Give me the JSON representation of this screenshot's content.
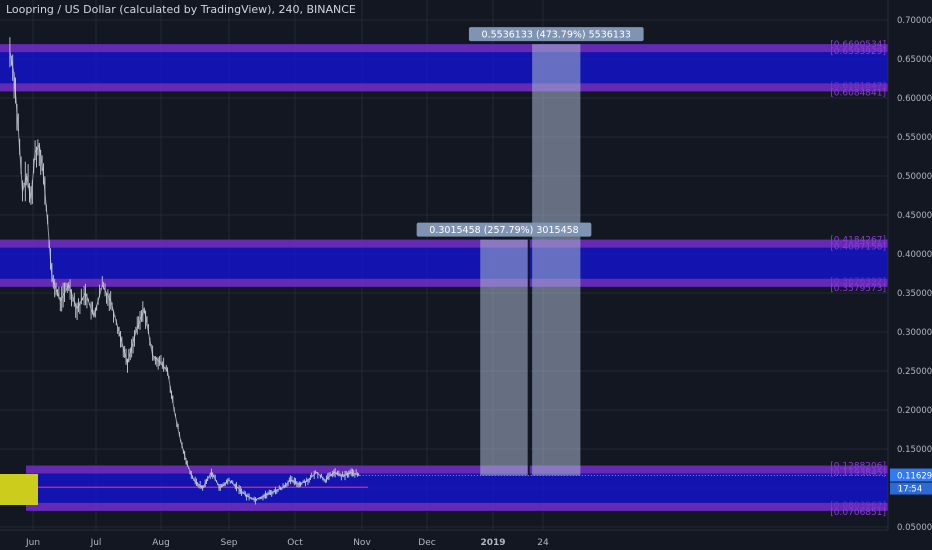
{
  "header": {
    "title": "Loopring / US Dollar (calculated by TradingView), 240, BINANCE"
  },
  "colors": {
    "background": "#131722",
    "grid": "#1f2a36",
    "axis_text": "#b2b5be",
    "zone_fill": "#1414e6",
    "zone_border": "#7a2fb5",
    "zone_label": "#8a3dd6",
    "measure_fill": "#a9b8d0",
    "measure_label_bg": "#7f93b3",
    "price_line": "#e0247f",
    "candle": "#c8ccd6",
    "price_tag": "#3179f5",
    "marker": "#cccc1c"
  },
  "chart_data": {
    "type": "line",
    "title": "Loopring / US Dollar (calculated by TradingView), 240, BINANCE",
    "xlabel": "",
    "ylabel": "",
    "grid": true,
    "x_ticks": [
      "Jun",
      "Jul",
      "Aug",
      "Sep",
      "Oct",
      "Nov",
      "Dec",
      "2019",
      "24"
    ],
    "y_ticks": [
      0.7,
      0.65,
      0.6,
      0.55,
      0.5,
      0.45,
      0.4,
      0.35,
      0.3,
      0.25,
      0.2,
      0.15,
      0.1,
      0.05
    ],
    "y_tick_labels": [
      "0.7000000",
      "0.6500000",
      "0.6000000",
      "0.5500000",
      "0.5000000",
      "0.4500000",
      "0.4000000",
      "0.3500000",
      "0.3000000",
      "0.2500000",
      "0.2000000",
      "0.1500000",
      "0.10",
      "0.0500000"
    ],
    "ylim": [
      0.03,
      0.718
    ],
    "current_price": {
      "value": 0.116,
      "label": "0.1162908",
      "countdown": "17:54"
    },
    "series": [
      {
        "values": [
          [
            "2018-05-21",
            0.66
          ],
          [
            "2018-05-23",
            0.63
          ],
          [
            "2018-05-25",
            0.56
          ],
          [
            "2018-05-27",
            0.48
          ],
          [
            "2018-05-29",
            0.5
          ],
          [
            "2018-05-31",
            0.47
          ],
          [
            "2018-06-02",
            0.53
          ],
          [
            "2018-06-04",
            0.54
          ],
          [
            "2018-06-06",
            0.5
          ],
          [
            "2018-06-08",
            0.44
          ],
          [
            "2018-06-10",
            0.37
          ],
          [
            "2018-06-14",
            0.34
          ],
          [
            "2018-06-18",
            0.36
          ],
          [
            "2018-06-22",
            0.33
          ],
          [
            "2018-06-26",
            0.35
          ],
          [
            "2018-06-30",
            0.32
          ],
          [
            "2018-07-04",
            0.36
          ],
          [
            "2018-07-08",
            0.34
          ],
          [
            "2018-07-12",
            0.3
          ],
          [
            "2018-07-16",
            0.26
          ],
          [
            "2018-07-20",
            0.3
          ],
          [
            "2018-07-24",
            0.33
          ],
          [
            "2018-07-28",
            0.27
          ],
          [
            "2018-08-01",
            0.26
          ],
          [
            "2018-08-04",
            0.25
          ],
          [
            "2018-08-07",
            0.2
          ],
          [
            "2018-08-10",
            0.16
          ],
          [
            "2018-08-13",
            0.13
          ],
          [
            "2018-08-16",
            0.11
          ],
          [
            "2018-08-20",
            0.1
          ],
          [
            "2018-08-24",
            0.12
          ],
          [
            "2018-08-28",
            0.1
          ],
          [
            "2018-09-01",
            0.11
          ],
          [
            "2018-09-05",
            0.1
          ],
          [
            "2018-09-09",
            0.09
          ],
          [
            "2018-09-13",
            0.085
          ],
          [
            "2018-09-17",
            0.09
          ],
          [
            "2018-09-21",
            0.095
          ],
          [
            "2018-09-25",
            0.1
          ],
          [
            "2018-09-29",
            0.11
          ],
          [
            "2018-10-03",
            0.105
          ],
          [
            "2018-10-07",
            0.11
          ],
          [
            "2018-10-11",
            0.12
          ],
          [
            "2018-10-15",
            0.11
          ],
          [
            "2018-10-19",
            0.12
          ],
          [
            "2018-10-23",
            0.115
          ],
          [
            "2018-10-27",
            0.12
          ],
          [
            "2018-10-31",
            0.116
          ]
        ]
      }
    ],
    "zones": [
      {
        "top": 0.6690534,
        "bottom": 0.6084841,
        "top_label": "0.6690534",
        "bottom_label": "0.6084841",
        "inner_labels": [
          "0.6593929",
          "0.6181847"
        ]
      },
      {
        "top": 0.4184267,
        "bottom": 0.3579573,
        "top_label": "0.4184267",
        "bottom_label": "0.3579573",
        "inner_labels": [
          "0.4087158",
          "0.3676392"
        ]
      },
      {
        "top": 0.1288206,
        "bottom": 0.0706851,
        "top_label": "0.1288206",
        "bottom_label": "0.0706851",
        "inner_labels": [
          "0.1193845",
          "0.0803962"
        ]
      }
    ],
    "measurements": [
      {
        "x_start": "2018-12-26",
        "x_end": "2019-01-17",
        "from": 0.116,
        "to": 0.4184267,
        "label": "0.3015458 (257.79%) 3015458"
      },
      {
        "x_start": "2019-01-19",
        "x_end": "2019-02-10",
        "from": 0.116,
        "to": 0.6690534,
        "label": "0.5536133 (473.79%) 5536133"
      }
    ],
    "horizontal_line": 0.101
  }
}
